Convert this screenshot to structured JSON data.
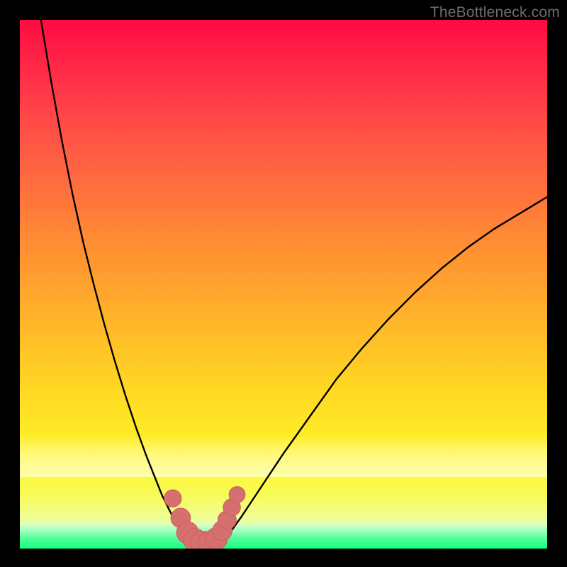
{
  "watermark": {
    "text": "TheBottleneck.com"
  },
  "colors": {
    "curve_stroke": "#000000",
    "marker_fill": "#d6706f",
    "marker_stroke": "#c95d5c"
  },
  "chart_data": {
    "type": "line",
    "title": "",
    "xlabel": "",
    "ylabel": "",
    "xlim": [
      0,
      100
    ],
    "ylim": [
      0,
      100
    ],
    "series": [
      {
        "name": "left-branch",
        "x": [
          4,
          6,
          8,
          10,
          12,
          14,
          16,
          18,
          20,
          22,
          24,
          26,
          27,
          28,
          29,
          30,
          31,
          32,
          33
        ],
        "y": [
          100,
          88,
          77,
          67,
          58,
          50,
          42.5,
          35.5,
          29,
          23,
          17.5,
          12.5,
          10,
          8,
          6,
          4.5,
          3,
          2,
          1.2
        ]
      },
      {
        "name": "right-branch",
        "x": [
          38,
          39,
          40,
          42,
          44,
          46,
          50,
          55,
          60,
          65,
          70,
          75,
          80,
          85,
          90,
          95,
          100
        ],
        "y": [
          1.2,
          2,
          3.2,
          6,
          9,
          12,
          18,
          25,
          32,
          38,
          43.5,
          48.5,
          53,
          57,
          60.5,
          63.5,
          66.5
        ]
      },
      {
        "name": "valley-floor",
        "x": [
          31,
          32,
          33,
          34,
          35,
          36,
          37,
          38,
          39
        ],
        "y": [
          3,
          1.8,
          1.1,
          0.8,
          0.8,
          0.9,
          1.1,
          1.8,
          3
        ]
      }
    ],
    "markers": {
      "name": "valley-markers",
      "points": [
        {
          "x": 29.0,
          "y": 9.5,
          "r": 1.0
        },
        {
          "x": 30.5,
          "y": 5.8,
          "r": 1.2
        },
        {
          "x": 31.8,
          "y": 3.0,
          "r": 1.4
        },
        {
          "x": 33.2,
          "y": 1.6,
          "r": 1.5
        },
        {
          "x": 34.6,
          "y": 1.1,
          "r": 1.5
        },
        {
          "x": 36.0,
          "y": 1.1,
          "r": 1.5
        },
        {
          "x": 37.3,
          "y": 1.9,
          "r": 1.4
        },
        {
          "x": 38.4,
          "y": 3.4,
          "r": 1.2
        },
        {
          "x": 39.3,
          "y": 5.4,
          "r": 1.1
        },
        {
          "x": 40.2,
          "y": 7.8,
          "r": 1.0
        },
        {
          "x": 41.2,
          "y": 10.2,
          "r": 0.9
        }
      ]
    }
  }
}
